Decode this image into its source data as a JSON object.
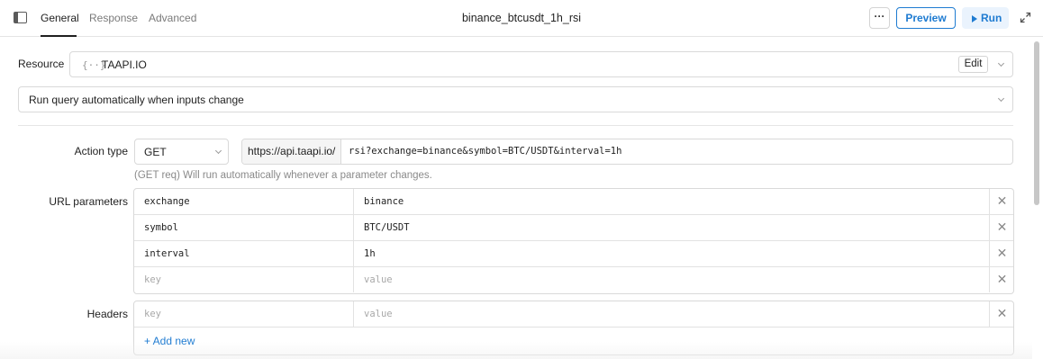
{
  "header": {
    "tabs": [
      {
        "label": "General",
        "active": true
      },
      {
        "label": "Response",
        "active": false
      },
      {
        "label": "Advanced",
        "active": false
      }
    ],
    "query_name": "binance_btcusdt_1h_rsi",
    "more_label": "···",
    "preview_label": "Preview",
    "run_label": "Run"
  },
  "resource": {
    "label": "Resource",
    "icon_text": "{··}",
    "name": "TAAPI.IO",
    "edit_label": "Edit"
  },
  "trigger": {
    "value": "Run query automatically when inputs change"
  },
  "action": {
    "label": "Action type",
    "method": "GET",
    "base_url": "https://api.taapi.io/",
    "path": "rsi?exchange=binance&symbol=BTC/USDT&interval=1h",
    "hint": "(GET req) Will run automatically whenever a parameter changes."
  },
  "url_params": {
    "label": "URL parameters",
    "rows": [
      {
        "key": "exchange",
        "value": "binance"
      },
      {
        "key": "symbol",
        "value": "BTC/USDT"
      },
      {
        "key": "interval",
        "value": "1h"
      }
    ],
    "key_placeholder": "key",
    "value_placeholder": "value",
    "delete_glyph": "✕"
  },
  "headers": {
    "label": "Headers",
    "key_placeholder": "key",
    "value_placeholder": "value",
    "add_label": "+ Add new"
  },
  "colors": {
    "accent": "#1e7bd1",
    "run_bg": "#eaf3fd",
    "border": "#d9d9d9"
  }
}
